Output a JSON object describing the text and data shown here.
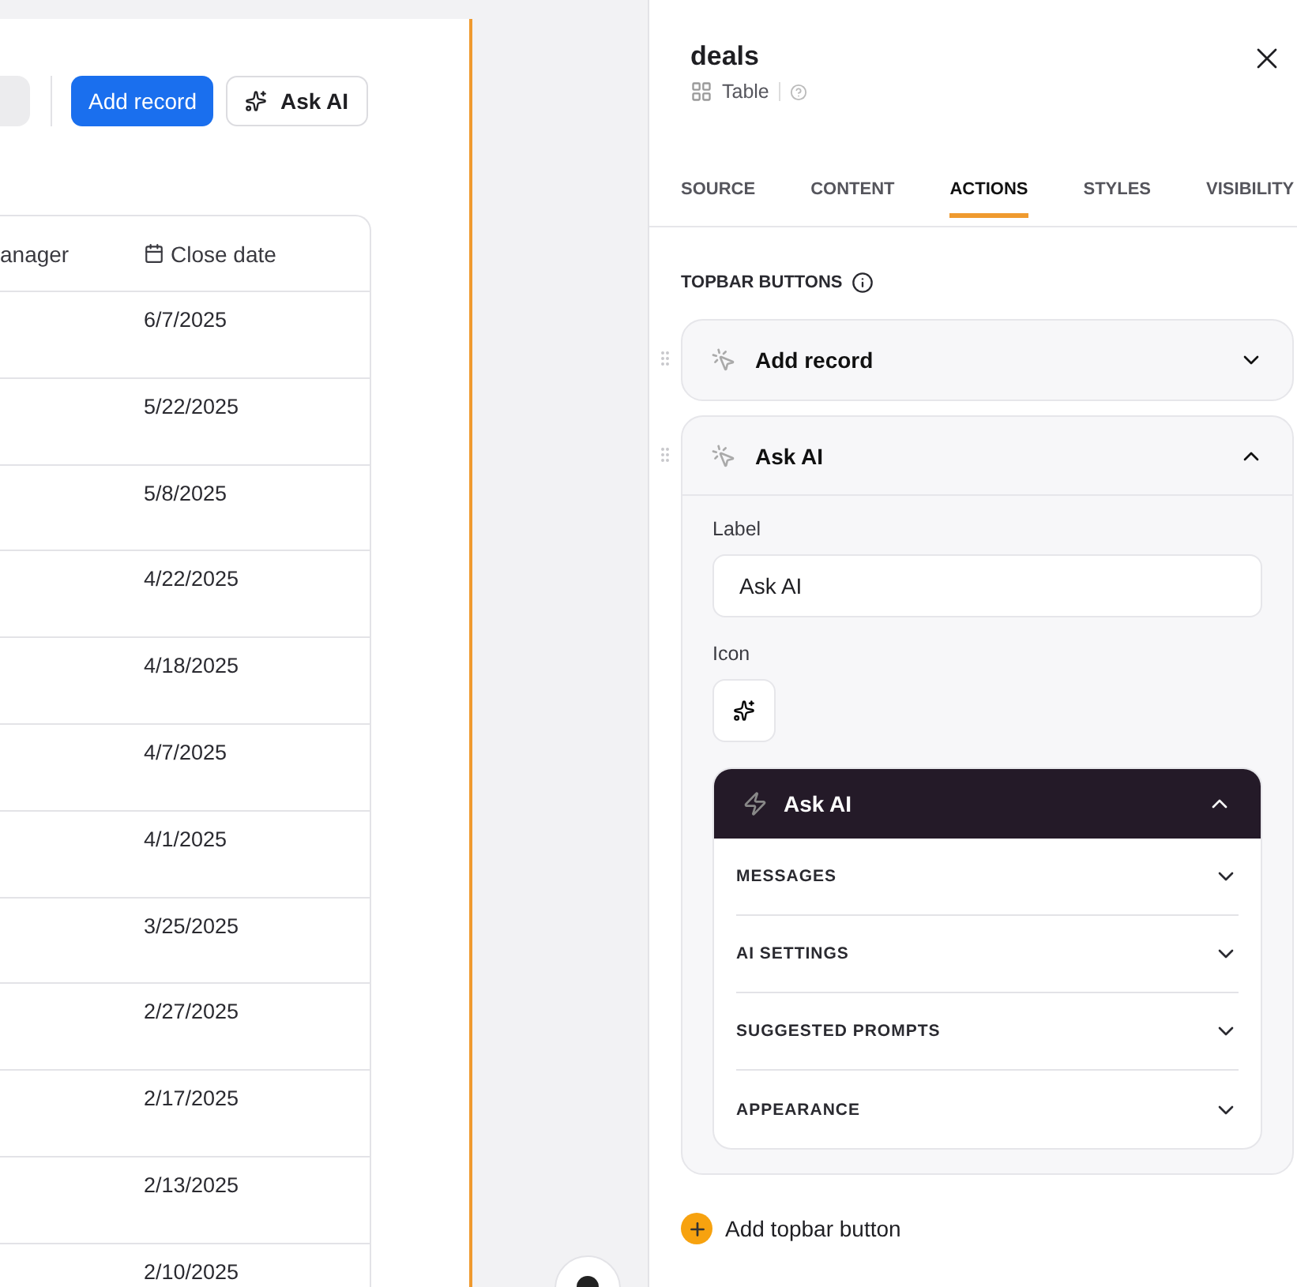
{
  "canvas": {
    "toolbar": [
      {
        "label": "Add record",
        "kind": "primary"
      },
      {
        "label": "Ask AI",
        "kind": "ai"
      }
    ],
    "table": {
      "columns": [
        {
          "label": "anager",
          "kind": "plain"
        },
        {
          "label": "Close date",
          "kind": "date"
        }
      ],
      "rows": [
        [
          "",
          "6/7/2025"
        ],
        [
          "",
          "5/22/2025"
        ],
        [
          "",
          "5/8/2025"
        ],
        [
          "",
          "4/22/2025"
        ],
        [
          "",
          "4/18/2025"
        ],
        [
          "",
          "4/7/2025"
        ],
        [
          "",
          "4/1/2025"
        ],
        [
          "",
          "3/25/2025"
        ],
        [
          "",
          "2/27/2025"
        ],
        [
          "",
          "2/17/2025"
        ],
        [
          "",
          "2/13/2025"
        ],
        [
          "",
          "2/10/2025"
        ]
      ]
    }
  },
  "panel": {
    "title": "deals",
    "subtitle": "Table",
    "tabs": [
      {
        "label": "SOURCE",
        "selected": false
      },
      {
        "label": "CONTENT",
        "selected": false
      },
      {
        "label": "ACTIONS",
        "selected": true
      },
      {
        "label": "STYLES",
        "selected": false
      },
      {
        "label": "VISIBILITY",
        "selected": false
      }
    ],
    "section_title": "TOPBAR BUTTONS",
    "topbar_buttons": [
      {
        "label": "Add record",
        "expanded": false
      },
      {
        "label": "Ask AI",
        "expanded": true,
        "field_label": "Label",
        "field_value": "Ask AI",
        "icon_label": "Icon",
        "action": {
          "title": "Ask AI",
          "expanded": true,
          "sections": [
            {
              "label": "MESSAGES",
              "expanded": false
            },
            {
              "label": "AI SETTINGS",
              "expanded": false
            },
            {
              "label": "SUGGESTED PROMPTS",
              "expanded": false
            },
            {
              "label": "APPEARANCE",
              "expanded": false
            }
          ]
        }
      }
    ],
    "add_button": "Add topbar button"
  }
}
